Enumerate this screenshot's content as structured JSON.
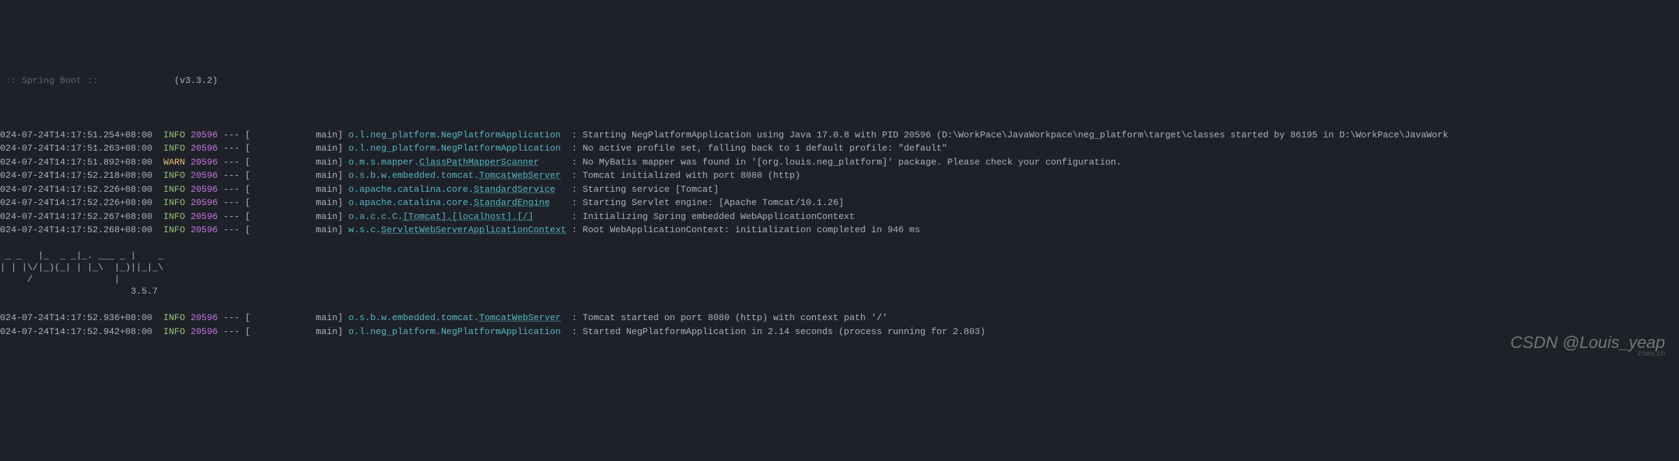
{
  "header": {
    "label": " :: Spring Boot :: ",
    "version": "(v3.3.2)"
  },
  "lines": [
    {
      "timestamp": "024-07-24T14:17:51.254+08:00",
      "level": "INFO",
      "levelClass": "level-info",
      "pid": "20596",
      "thread": "main]",
      "loggerPrefix": "o.l.neg_platform.",
      "loggerLinked": "NegPlatformApplication",
      "loggerLinkedClass": "logger",
      "message": ": Starting NegPlatformApplication using Java 17.0.8 with PID 20596 (D:\\WorkPace\\JavaWorkpace\\neg_platform\\target\\classes started by 86195 in D:\\WorkPace\\JavaWork"
    },
    {
      "timestamp": "024-07-24T14:17:51.263+08:00",
      "level": "INFO",
      "levelClass": "level-info",
      "pid": "20596",
      "thread": "main]",
      "loggerPrefix": "o.l.neg_platform.",
      "loggerLinked": "NegPlatformApplication",
      "loggerLinkedClass": "logger",
      "message": ": No active profile set, falling back to 1 default profile: \"default\""
    },
    {
      "timestamp": "024-07-24T14:17:51.892+08:00",
      "level": "WARN",
      "levelClass": "level-warn",
      "pid": "20596",
      "thread": "main]",
      "loggerPrefix": "o.m.s.mapper.",
      "loggerLinked": "ClassPathMapperScanner",
      "loggerLinkedClass": "logger-linked",
      "message": ": No MyBatis mapper was found in '[org.louis.neg_platform]' package. Please check your configuration."
    },
    {
      "timestamp": "024-07-24T14:17:52.218+08:00",
      "level": "INFO",
      "levelClass": "level-info",
      "pid": "20596",
      "thread": "main]",
      "loggerPrefix": "o.s.b.w.embedded.tomcat.",
      "loggerLinked": "TomcatWebServer",
      "loggerLinkedClass": "logger-linked",
      "message": ": Tomcat initialized with port 8080 (http)"
    },
    {
      "timestamp": "024-07-24T14:17:52.226+08:00",
      "level": "INFO",
      "levelClass": "level-info",
      "pid": "20596",
      "thread": "main]",
      "loggerPrefix": "o.apache.catalina.core.",
      "loggerLinked": "StandardService",
      "loggerLinkedClass": "logger-linked",
      "message": ": Starting service [Tomcat]"
    },
    {
      "timestamp": "024-07-24T14:17:52.226+08:00",
      "level": "INFO",
      "levelClass": "level-info",
      "pid": "20596",
      "thread": "main]",
      "loggerPrefix": "o.apache.catalina.core.",
      "loggerLinked": "StandardEngine",
      "loggerLinkedClass": "logger-linked",
      "message": ": Starting Servlet engine: [Apache Tomcat/10.1.26]"
    },
    {
      "timestamp": "024-07-24T14:17:52.267+08:00",
      "level": "INFO",
      "levelClass": "level-info",
      "pid": "20596",
      "thread": "main]",
      "loggerPrefix": "o.a.c.c.C.",
      "loggerLinked": "[Tomcat].[localhost].[/]",
      "loggerLinkedClass": "logger-linked",
      "message": ": Initializing Spring embedded WebApplicationContext"
    },
    {
      "timestamp": "024-07-24T14:17:52.268+08:00",
      "level": "INFO",
      "levelClass": "level-info",
      "pid": "20596",
      "thread": "main]",
      "loggerPrefix": "w.s.c.",
      "loggerLinked": "ServletWebServerApplicationContext",
      "loggerLinkedClass": "logger-linked",
      "message": ": Root WebApplicationContext: initialization completed in 946 ms"
    }
  ],
  "asciiArt": [
    " _ _   |_  _ _|_. ___ _ |    _ ",
    "| | |\\/|_)(_| | |_\\  |_)||_|_\\ ",
    "     /               |         ",
    "                        3.5.7 "
  ],
  "linesAfter": [
    {
      "timestamp": "024-07-24T14:17:52.936+08:00",
      "level": "INFO",
      "levelClass": "level-info",
      "pid": "20596",
      "thread": "main]",
      "loggerPrefix": "o.s.b.w.embedded.tomcat.",
      "loggerLinked": "TomcatWebServer",
      "loggerLinkedClass": "logger-linked",
      "message": ": Tomcat started on port 8080 (http) with context path '/'"
    },
    {
      "timestamp": "024-07-24T14:17:52.942+08:00",
      "level": "INFO",
      "levelClass": "level-info",
      "pid": "20596",
      "thread": "main]",
      "loggerPrefix": "o.l.neg_platform.",
      "loggerLinked": "NegPlatformApplication",
      "loggerLinkedClass": "logger",
      "message": ": Started NegPlatformApplication in 2.14 seconds (process running for 2.803)"
    }
  ],
  "watermark": {
    "main": "CSDN @Louis_yeap",
    "small": "znwx.ch"
  }
}
